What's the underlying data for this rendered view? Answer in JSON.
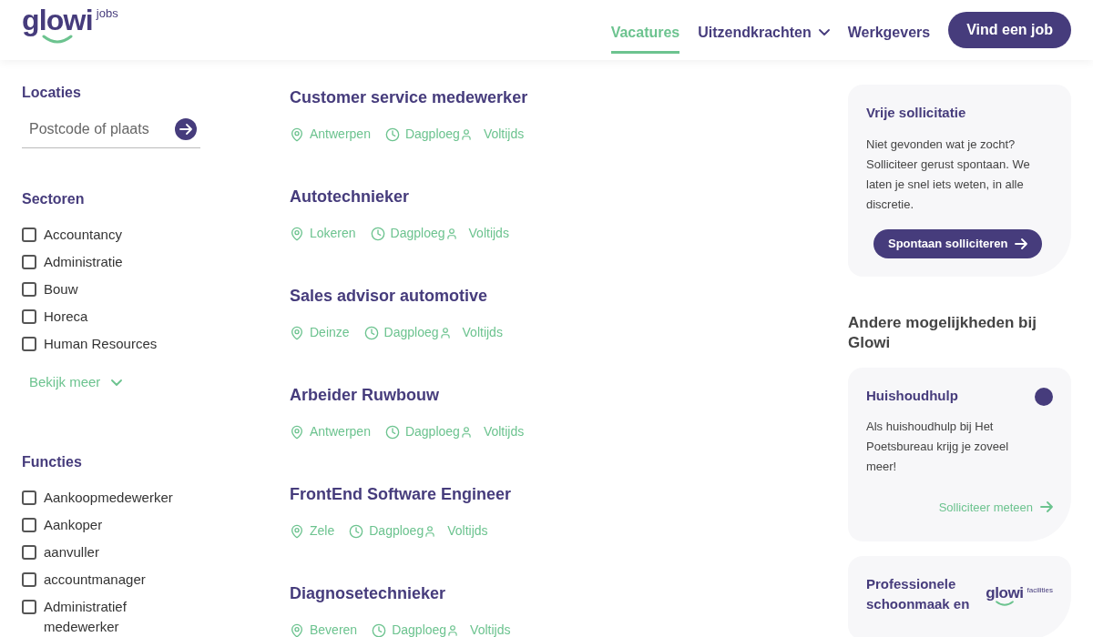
{
  "header": {
    "logo": {
      "name": "glowi",
      "suffix": "jobs"
    },
    "nav": [
      {
        "label": "Vacatures",
        "selected": true,
        "dropdown": false
      },
      {
        "label": "Uitzendkrachten",
        "selected": false,
        "dropdown": true
      },
      {
        "label": "Werkgevers",
        "selected": false,
        "dropdown": false
      }
    ],
    "cta": "Vind een job"
  },
  "filters": {
    "locations": {
      "title": "Locaties",
      "placeholder": "Postcode of plaats"
    },
    "sectors": {
      "title": "Sectoren",
      "items": [
        {
          "label": "Accountancy",
          "checked": false
        },
        {
          "label": "Administratie",
          "checked": false
        },
        {
          "label": "Bouw",
          "checked": false
        },
        {
          "label": "Horeca",
          "checked": false
        },
        {
          "label": "Human Resources",
          "checked": false
        }
      ],
      "more": "Bekijk meer"
    },
    "functions": {
      "title": "Functies",
      "items": [
        {
          "label": "Aankoopmedewerker",
          "checked": false
        },
        {
          "label": "Aankoper",
          "checked": false
        },
        {
          "label": "aanvuller",
          "checked": false
        },
        {
          "label": "accountmanager",
          "checked": false
        },
        {
          "label": "Administratief medewerker",
          "checked": false
        }
      ]
    }
  },
  "jobs": [
    {
      "title": "Customer service medewerker",
      "location": "Antwerpen",
      "shift": "Dagploeg",
      "regime": "Voltijds"
    },
    {
      "title": "Autotechnieker",
      "location": "Lokeren",
      "shift": "Dagploeg",
      "regime": "Voltijds"
    },
    {
      "title": "Sales advisor automotive",
      "location": "Deinze",
      "shift": "Dagploeg",
      "regime": "Voltijds"
    },
    {
      "title": "Arbeider Ruwbouw",
      "location": "Antwerpen",
      "shift": "Dagploeg",
      "regime": "Voltijds"
    },
    {
      "title": "FrontEnd Software Engineer",
      "location": "Zele",
      "shift": "Dagploeg",
      "regime": "Voltijds"
    },
    {
      "title": "Diagnosetechnieker",
      "location": "Beveren",
      "shift": "Dagploeg",
      "regime": "Voltijds"
    }
  ],
  "sidebar": {
    "spontaneous": {
      "title": "Vrije sollicitatie",
      "text": "Niet gevonden wat je zocht? Solliciteer gerust spontaan. We laten je snel iets weten, in alle discretie.",
      "button": "Spontaan solliciteren"
    },
    "other_title": "Andere mogelijkheden bij Glowi",
    "cards": [
      {
        "kind": "badge",
        "title": "Huishoudhulp",
        "text": "Als huishoudhulp bij Het Poetsbureau krijg je zoveel meer!",
        "link": "Solliciteer meteen"
      },
      {
        "kind": "logo",
        "title": "Professionele schoonmaak en",
        "logo": {
          "name": "glowi",
          "suffix": "facilities"
        }
      }
    ]
  }
}
